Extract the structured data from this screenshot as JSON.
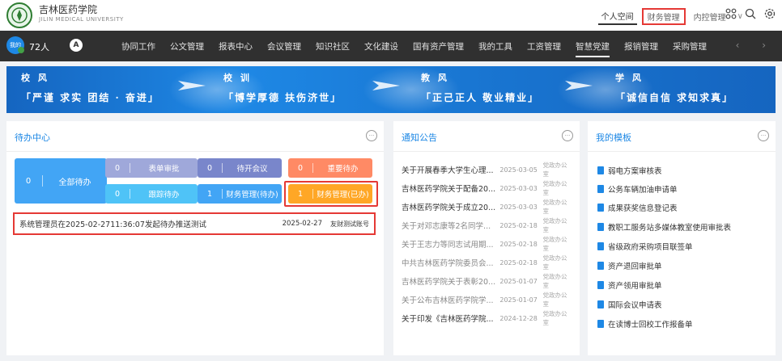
{
  "header": {
    "school_name": "吉林医药学院",
    "school_sub": "JILIN MEDICAL UNIVERSITY",
    "links": [
      "个人空间",
      "财务管理",
      "内控管理"
    ],
    "dropdown_glyph": "∨",
    "icons": [
      "grid-icon",
      "search-icon",
      "settings-icon"
    ]
  },
  "nav": {
    "avatar_text": "我的",
    "count": "72人",
    "compass_glyph": "A",
    "items": [
      "协同工作",
      "公文管理",
      "报表中心",
      "会议管理",
      "知识社区",
      "文化建设",
      "国有资产管理",
      "我的工具",
      "工资管理",
      "智慧党建",
      "报销管理",
      "采购管理"
    ]
  },
  "banner": [
    {
      "title": "校 风",
      "motto": "「严谨  求实  团结 · 奋进」"
    },
    {
      "title": "校 训",
      "motto": "「博学厚德  扶伤济世」"
    },
    {
      "title": "教 风",
      "motto": "「正己正人  敬业精业」"
    },
    {
      "title": "学 风",
      "motto": "「诚信自信  求知求真」"
    }
  ],
  "todo": {
    "title": "待办中心",
    "more": "···",
    "all": {
      "count": "0",
      "label": "全部待办"
    },
    "tiles": [
      {
        "count": "0",
        "label": "表单审批",
        "color": "#9fa8da"
      },
      {
        "count": "0",
        "label": "待开会议",
        "color": "#9fa8da"
      },
      {
        "count": "0",
        "label": "重要待办",
        "color": "#ff8a65"
      },
      {
        "count": "0",
        "label": "跟踪待办",
        "color": "#4fc3f7"
      },
      {
        "count": "1",
        "label": "财务管理(待办)",
        "color": "#42a5f5"
      },
      {
        "count": "1",
        "label": "财务管理(已办)",
        "color": "#ffa726"
      }
    ],
    "item": {
      "text": "系统管理员在2025-02-2711:36:07发起待办推送测试",
      "date": "2025-02-27",
      "owner": "友财测试账号"
    }
  },
  "notices": {
    "title": "通知公告",
    "more": "···",
    "items": [
      {
        "title": "关于开展春季大学生心理...",
        "date": "2025-03-05",
        "org": "党政办公室",
        "faded": false
      },
      {
        "title": "吉林医药学院关于配备20...",
        "date": "2025-03-03",
        "org": "党政办公室",
        "faded": false
      },
      {
        "title": "吉林医药学院关于成立20...",
        "date": "2025-03-03",
        "org": "党政办公室",
        "faded": false
      },
      {
        "title": "关于对邓志康等2名同学...",
        "date": "2025-02-18",
        "org": "党政办公室",
        "faded": true
      },
      {
        "title": "关于王志力等同志试用期...",
        "date": "2025-02-18",
        "org": "党政办公室",
        "faded": true
      },
      {
        "title": "中共吉林医药学院委员会...",
        "date": "2025-02-18",
        "org": "党政办公室",
        "faded": true
      },
      {
        "title": "吉林医药学院关于表彰20...",
        "date": "2025-01-07",
        "org": "党政办公室",
        "faded": true
      },
      {
        "title": "关于公布吉林医药学院学...",
        "date": "2025-01-07",
        "org": "党政办公室",
        "faded": true
      },
      {
        "title": "关于印发《吉林医药学院...",
        "date": "2024-12-28",
        "org": "党政办公室",
        "faded": false
      }
    ]
  },
  "templates": {
    "title": "我的模板",
    "more": "···",
    "items": [
      "弱电方案审核表",
      "公务车辆加油申请单",
      "成果获奖信息登记表",
      "教职工服务站多媒体教室使用审批表",
      "省级政府采购项目联签单",
      "资产退回审批单",
      "资产领用审批单",
      "国际会议申请表",
      "在读博士回校工作报备单"
    ]
  }
}
